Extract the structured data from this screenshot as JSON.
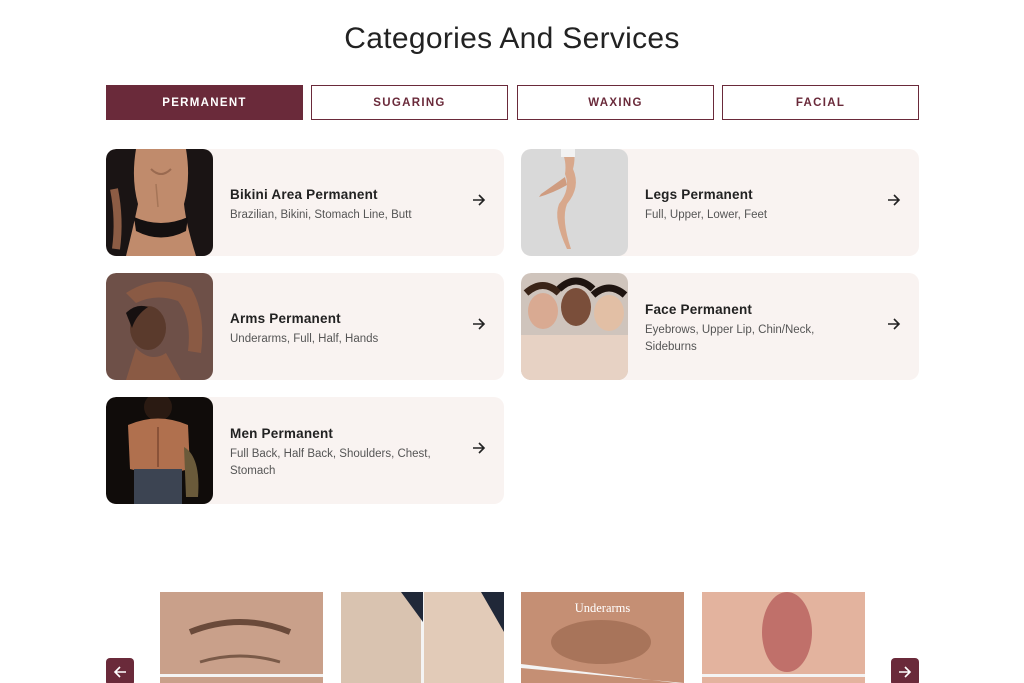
{
  "page": {
    "title": "Categories And Services"
  },
  "tabs": [
    {
      "label": "PERMANENT",
      "active": true
    },
    {
      "label": "SUGARING",
      "active": false
    },
    {
      "label": "WAXING",
      "active": false
    },
    {
      "label": "FACIAL",
      "active": false
    }
  ],
  "services": [
    {
      "title": "Bikini Area Permanent",
      "details": "Brazilian, Bikini, Stomach Line, Butt",
      "icon": "arrow-right-icon"
    },
    {
      "title": "Legs Permanent",
      "details": "Full, Upper, Lower, Feet",
      "icon": "arrow-right-icon"
    },
    {
      "title": "Arms Permanent",
      "details": "Underarms, Full, Half, Hands",
      "icon": "arrow-right-icon"
    },
    {
      "title": "Face Permanent",
      "details": "Eyebrows, Upper Lip, Chin/Neck, Sideburns",
      "icon": "arrow-right-icon"
    },
    {
      "title": "Men Permanent",
      "details": "Full Back, Half Back, Shoulders, Chest, Stomach",
      "icon": "arrow-right-icon"
    }
  ],
  "gallery": {
    "tiles": [
      {
        "caption": ""
      },
      {
        "caption": ""
      },
      {
        "caption": "Underarms"
      },
      {
        "caption": ""
      }
    ],
    "prev_icon": "arrow-left-icon",
    "next_icon": "arrow-right-icon"
  },
  "colors": {
    "accent": "#6a2a3a",
    "card_bg": "#f9f3f1"
  }
}
